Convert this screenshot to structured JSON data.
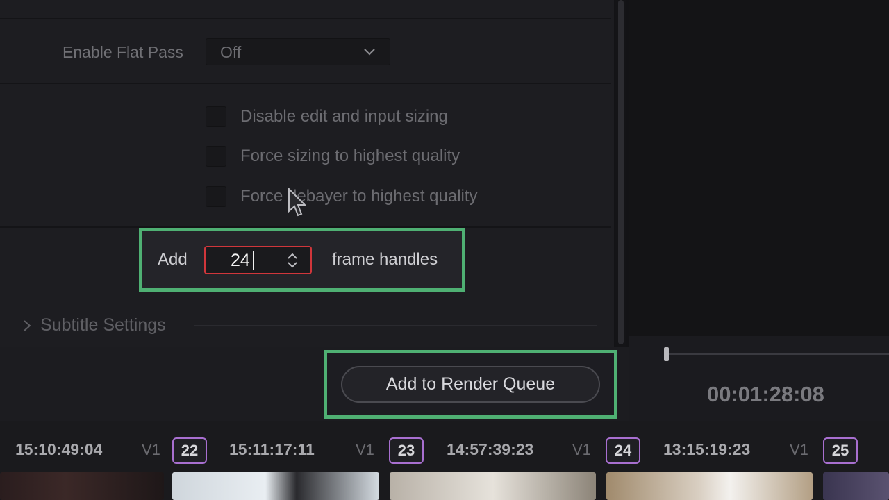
{
  "render_settings": {
    "flat_pass": {
      "label": "Enable Flat Pass",
      "value": "Off"
    },
    "checkboxes": [
      {
        "label": "Disable edit and input sizing",
        "checked": false
      },
      {
        "label": "Force sizing to highest quality",
        "checked": false
      },
      {
        "label": "Force debayer to highest quality",
        "checked": false
      }
    ],
    "handles": {
      "prefix": "Add",
      "value": "24",
      "suffix": "frame handles"
    },
    "subtitle_section": "Subtitle Settings",
    "render_button": "Add to Render Queue"
  },
  "viewer": {
    "timecode": "00:01:28:08"
  },
  "timeline": {
    "clips": [
      {
        "timecode": "15:10:49:04",
        "track": "V1",
        "clip_number": "22"
      },
      {
        "timecode": "15:11:17:11",
        "track": "V1",
        "clip_number": "23"
      },
      {
        "timecode": "14:57:39:23",
        "track": "V1",
        "clip_number": "24"
      },
      {
        "timecode": "13:15:19:23",
        "track": "V1",
        "clip_number": "25"
      }
    ]
  },
  "colors": {
    "highlight": "#4fb073",
    "stepper_border": "#d0363b",
    "panel_bg": "#1d1d21"
  }
}
